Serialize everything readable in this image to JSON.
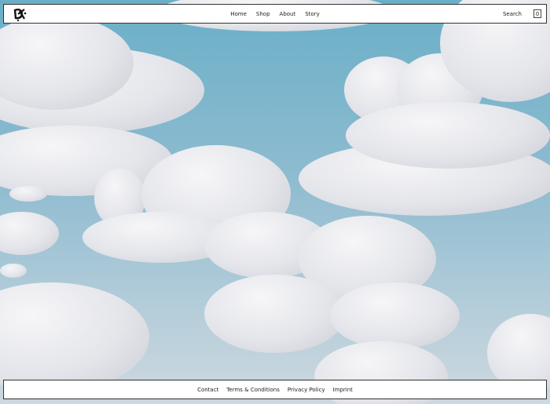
{
  "header": {
    "logo": "DX",
    "nav": [
      "Home",
      "Shop",
      "About",
      "Story"
    ],
    "search_label": "Search",
    "cart_count": "0"
  },
  "footer": {
    "links": [
      "Contact",
      "Terms & Conditions",
      "Privacy Policy",
      "Imprint"
    ]
  }
}
